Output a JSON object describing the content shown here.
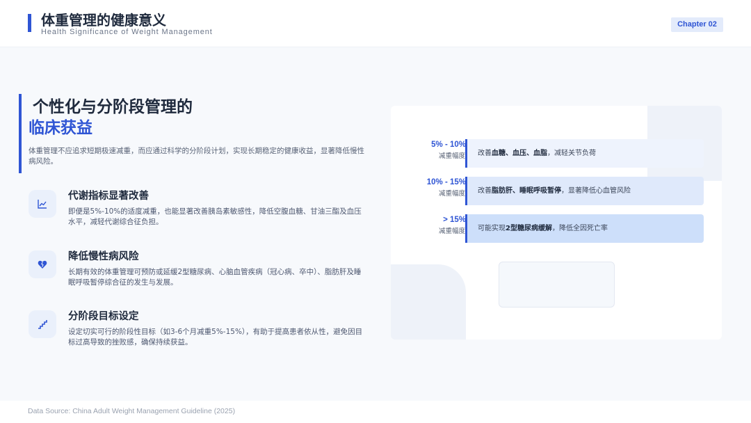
{
  "header": {
    "title": "体重管理的健康意义",
    "subtitle": "Health Significance of Weight Management",
    "chapter": "Chapter 02"
  },
  "intro": {
    "heading_line1": "个性化与分阶段管理的",
    "heading_line2": "临床获益",
    "text": "体重管理不应追求短期极速减重，而应通过科学的分阶段计划，实现长期稳定的健康收益，显著降低慢性病风险。"
  },
  "features": [
    {
      "icon": "trend-chart-icon",
      "title": "代谢指标显著改善",
      "text": "即便是5%-10%的适度减重，也能显著改善胰岛素敏感性，降低空腹血糖、甘油三酯及血压水平，减轻代谢综合征负担。"
    },
    {
      "icon": "broken-heart-icon",
      "title": "降低慢性病风险",
      "text": "长期有效的体重管理可预防或延缓2型糖尿病、心脑血管疾病（冠心病、卒中）、脂肪肝及睡眠呼吸暂停综合征的发生与发展。"
    },
    {
      "icon": "stairs-icon",
      "title": "分阶段目标设定",
      "text": "设定切实可行的阶段性目标（如3-6个月减重5%-15%），有助于提高患者依从性，避免因目标过高导致的挫败感，确保持续获益。"
    }
  ],
  "ranges": [
    {
      "value": "5% - 10%",
      "label": "减重幅度",
      "prefix": "改善",
      "bold": "血糖、血压、血脂",
      "suffix": "，减轻关节负荷",
      "color": "#eef3fd"
    },
    {
      "value": "10% - 15%",
      "label": "减重幅度",
      "prefix": "改善",
      "bold": "脂肪肝、睡眠呼吸暂停",
      "suffix": "，显著降低心血管风险",
      "color": "#dfe9fb"
    },
    {
      "value": "> 15%",
      "label": "减重幅度",
      "prefix": "可能实现",
      "bold": "2型糖尿病缓解",
      "suffix": "，降低全因死亡率",
      "color": "#cddffa"
    }
  ],
  "footer": {
    "source": "Data Source: China Adult Weight Management Guideline (2025)"
  },
  "colors": {
    "accent": "#2f55d4",
    "background": "#f7f9fc"
  }
}
